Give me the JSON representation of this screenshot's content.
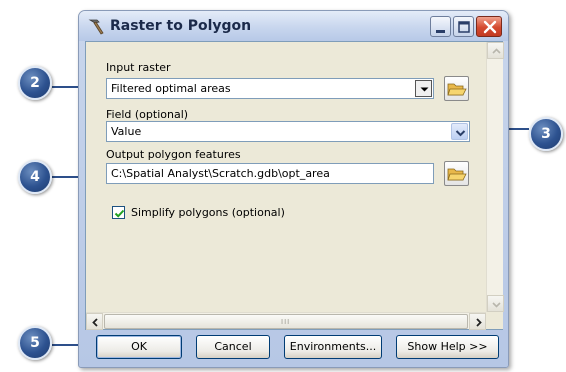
{
  "window": {
    "title": "Raster to Polygon",
    "title_icon": "hammer-tool-icon",
    "controls": [
      "minimize-icon",
      "maximize-icon",
      "close-icon"
    ]
  },
  "form": {
    "input_raster": {
      "label": "Input raster",
      "value": "Filtered optimal areas",
      "browse_icon": "open-folder-icon"
    },
    "field": {
      "label": "Field (optional)",
      "value": "Value"
    },
    "output": {
      "label": "Output polygon features",
      "value": "C:\\Spatial  Analyst\\Scratch.gdb\\opt_area",
      "browse_icon": "open-folder-icon"
    },
    "simplify": {
      "label": "Simplify polygons (optional)",
      "checked": true
    }
  },
  "buttons": {
    "ok": "OK",
    "cancel": "Cancel",
    "environments": "Environments...",
    "help": "Show Help >>"
  },
  "scrollbar": {
    "grip": "III"
  },
  "callouts": [
    "2",
    "3",
    "4",
    "5"
  ],
  "colors": {
    "callout_fill": "#2d5290",
    "leader_line": "#2d4f8a",
    "close_button": "#d44a30",
    "dialog_bg": "#ece9d8"
  }
}
